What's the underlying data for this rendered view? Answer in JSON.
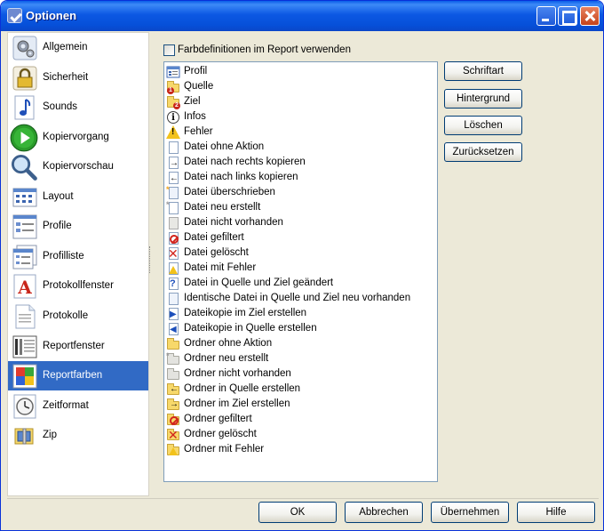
{
  "window": {
    "title": "Optionen"
  },
  "sidebar": {
    "items": [
      {
        "label": "Allgemein",
        "icon": "gear-icon"
      },
      {
        "label": "Sicherheit",
        "icon": "lock-icon"
      },
      {
        "label": "Sounds",
        "icon": "music-note-icon"
      },
      {
        "label": "Kopiervorgang",
        "icon": "play-icon"
      },
      {
        "label": "Kopiervorschau",
        "icon": "magnifier-icon"
      },
      {
        "label": "Layout",
        "icon": "layout-icon"
      },
      {
        "label": "Profile",
        "icon": "profile-list-icon"
      },
      {
        "label": "Profilliste",
        "icon": "profile-list-stack-icon"
      },
      {
        "label": "Protokollfenster",
        "icon": "letter-a-icon"
      },
      {
        "label": "Protokolle",
        "icon": "document-icon"
      },
      {
        "label": "Reportfenster",
        "icon": "report-window-icon"
      },
      {
        "label": "Reportfarben",
        "icon": "color-palette-icon",
        "selected": true
      },
      {
        "label": "Zeitformat",
        "icon": "clock-icon"
      },
      {
        "label": "Zip",
        "icon": "zip-icon"
      }
    ]
  },
  "main": {
    "checkbox_label": "Farbdefinitionen im Report verwenden",
    "checkbox_checked": false,
    "list_items": [
      {
        "label": "Profil",
        "icon": "profile-icon"
      },
      {
        "label": "Quelle",
        "icon": "source-folder-icon"
      },
      {
        "label": "Ziel",
        "icon": "target-folder-icon"
      },
      {
        "label": "Infos",
        "icon": "info-icon"
      },
      {
        "label": "Fehler",
        "icon": "warning-icon"
      },
      {
        "label": "Datei ohne Aktion",
        "icon": "file-icon"
      },
      {
        "label": "Datei nach rechts kopieren",
        "icon": "file-arrow-right-icon"
      },
      {
        "label": "Datei nach links kopieren",
        "icon": "file-arrow-left-icon"
      },
      {
        "label": "Datei überschrieben",
        "icon": "file-overwritten-icon"
      },
      {
        "label": "Datei neu erstellt",
        "icon": "file-new-icon"
      },
      {
        "label": "Datei nicht vorhanden",
        "icon": "file-missing-icon"
      },
      {
        "label": "Datei gefiltert",
        "icon": "file-filtered-icon"
      },
      {
        "label": "Datei gelöscht",
        "icon": "file-deleted-icon"
      },
      {
        "label": "Datei mit Fehler",
        "icon": "file-error-icon"
      },
      {
        "label": "Datei in Quelle und Ziel geändert",
        "icon": "file-changed-icon"
      },
      {
        "label": "Identische Datei in Quelle und Ziel neu vorhanden",
        "icon": "file-identical-icon"
      },
      {
        "label": "Dateikopie im Ziel erstellen",
        "icon": "file-copy-target-icon"
      },
      {
        "label": "Dateikopie in Quelle erstellen",
        "icon": "file-copy-source-icon"
      },
      {
        "label": "Ordner ohne Aktion",
        "icon": "folder-icon"
      },
      {
        "label": "Ordner neu erstellt",
        "icon": "folder-new-icon"
      },
      {
        "label": "Ordner nicht vorhanden",
        "icon": "folder-missing-icon"
      },
      {
        "label": "Ordner in Quelle erstellen",
        "icon": "folder-arrow-left-icon"
      },
      {
        "label": "Ordner im Ziel erstellen",
        "icon": "folder-arrow-right-icon"
      },
      {
        "label": "Ordner gefiltert",
        "icon": "folder-filtered-icon"
      },
      {
        "label": "Ordner gelöscht",
        "icon": "folder-deleted-icon"
      },
      {
        "label": "Ordner mit Fehler",
        "icon": "folder-error-icon"
      }
    ],
    "buttons": {
      "font": "Schriftart",
      "background": "Hintergrund",
      "delete": "Löschen",
      "reset": "Zurücksetzen"
    }
  },
  "footer": {
    "ok": "OK",
    "cancel": "Abbrechen",
    "apply": "Übernehmen",
    "help": "Hilfe"
  }
}
